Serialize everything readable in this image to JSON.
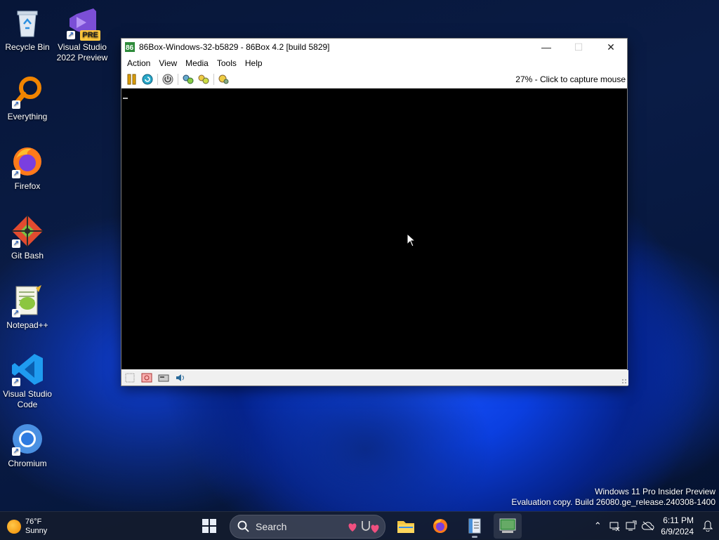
{
  "desktop": {
    "icons": [
      {
        "label": "Recycle Bin"
      },
      {
        "label": "Visual Studio 2022 Preview",
        "badge": "PRE"
      },
      {
        "label": "Everything"
      },
      {
        "label": "Firefox"
      },
      {
        "label": "Git Bash"
      },
      {
        "label": "Notepad++"
      },
      {
        "label": "Visual Studio Code"
      },
      {
        "label": "Chromium"
      }
    ]
  },
  "window": {
    "title": "86Box-Windows-32-b5829 - 86Box 4.2 [build 5829]",
    "menu": [
      "Action",
      "View",
      "Media",
      "Tools",
      "Help"
    ],
    "toolbar": {
      "icons": [
        "pause-icon",
        "reset-icon",
        "power-icon",
        "settings-icon",
        "cdrom-icon",
        "screenshot-icon"
      ],
      "capture_text": "27% - Click to capture mouse"
    },
    "statusbar_icons": [
      "floppy-icon",
      "cd-icon",
      "hdd-icon",
      "sound-icon"
    ]
  },
  "watermark": {
    "line1": "Windows 11 Pro Insider Preview",
    "line2": "Evaluation copy. Build 26080.ge_release.240308-1400"
  },
  "taskbar": {
    "weather_temp": "76°F",
    "weather_cond": "Sunny",
    "search_placeholder": "Search",
    "time": "6:11 PM",
    "date": "6/9/2024"
  },
  "colors": {
    "accent": "#5fb2ff",
    "taskbar": "#141c2e",
    "screen": "#000000"
  }
}
